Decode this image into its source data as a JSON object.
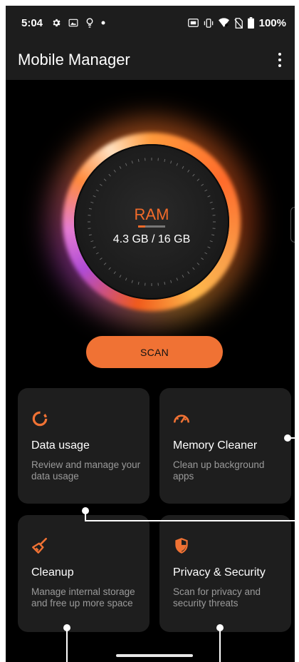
{
  "status": {
    "time": "5:04",
    "left_icons": [
      "gear-icon",
      "image-icon",
      "bulb-icon",
      "dot-icon"
    ],
    "right_icons": [
      "nfc-icon",
      "vibrate-icon",
      "wifi-icon",
      "no-sim-icon",
      "battery-icon"
    ],
    "battery": "100%"
  },
  "appbar": {
    "title": "Mobile Manager",
    "menu_icon": "more-vert-icon"
  },
  "ram": {
    "label": "RAM",
    "value": "4.3 GB / 16 GB",
    "used_fraction": 0.27
  },
  "scan": {
    "label": "SCAN"
  },
  "cards": [
    {
      "title": "Data usage",
      "desc": "Review and manage your data usage",
      "icon": "data-usage-icon"
    },
    {
      "title": "Memory Cleaner",
      "desc": "Clean up background apps",
      "icon": "speedometer-icon"
    },
    {
      "title": "Cleanup",
      "desc": "Manage internal storage and free up more space",
      "icon": "broom-icon"
    },
    {
      "title": "Privacy & Security",
      "desc": "Scan for privacy and security threats",
      "icon": "shield-icon"
    }
  ],
  "colors": {
    "accent": "#f07234",
    "background": "#000000",
    "card": "#1e1e1e",
    "bar": "#1d1d1d"
  }
}
